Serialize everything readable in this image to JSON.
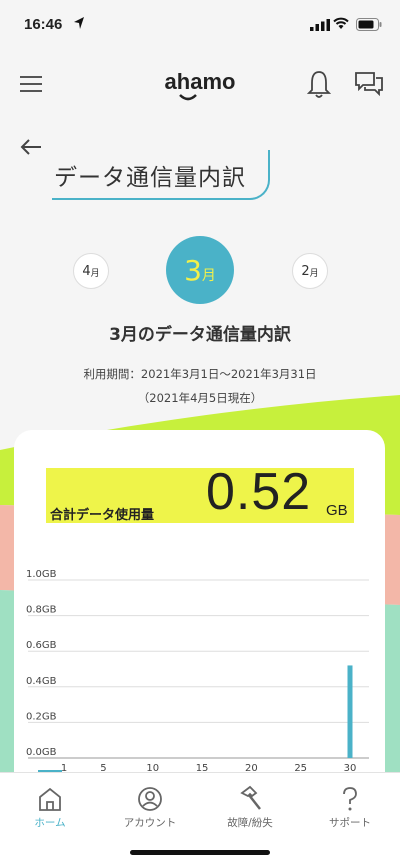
{
  "status_bar": {
    "time": "16:46"
  },
  "app": {
    "logo_text": "ahamo"
  },
  "page": {
    "title": "データ通信量内訳"
  },
  "months": {
    "prev": {
      "num": "4",
      "unit": "月"
    },
    "current": {
      "num": "3",
      "unit": "月"
    },
    "next": {
      "num": "2",
      "unit": "月"
    }
  },
  "section": {
    "title": "3月のデータ通信量内訳",
    "period": "利用期間：2021年3月1日〜2021年3月31日",
    "as_of": "（2021年4月5日現在）"
  },
  "total": {
    "label": "合計データ使用量",
    "value": "0.52",
    "unit": "GB"
  },
  "chart_data": {
    "type": "bar",
    "x_ticks": [
      "1",
      "5",
      "10",
      "15",
      "20",
      "25",
      "30"
    ],
    "y_ticks": [
      "0.0GB",
      "0.2GB",
      "0.4GB",
      "0.6GB",
      "0.8GB",
      "1.0GB"
    ],
    "ylim": [
      0,
      1.0
    ],
    "xlim": [
      1,
      31
    ],
    "values": [
      {
        "day": 30,
        "value": 0.52
      }
    ],
    "colors": {
      "bar": "#4ab2c8",
      "grid": "#dddddd"
    }
  },
  "tabs": [
    {
      "label": "ホーム",
      "icon": "home-icon",
      "active": true
    },
    {
      "label": "アカウント",
      "icon": "account-icon",
      "active": false
    },
    {
      "label": "故障/紛失",
      "icon": "hammer-icon",
      "active": false
    },
    {
      "label": "サポート",
      "icon": "question-icon",
      "active": false
    }
  ],
  "colors": {
    "accent": "#4ab2c8",
    "highlight": "#eef44a",
    "wave_green": "#c7f03c",
    "wave_pink": "#f3b7a8",
    "wave_mint": "#9fe0c2"
  }
}
